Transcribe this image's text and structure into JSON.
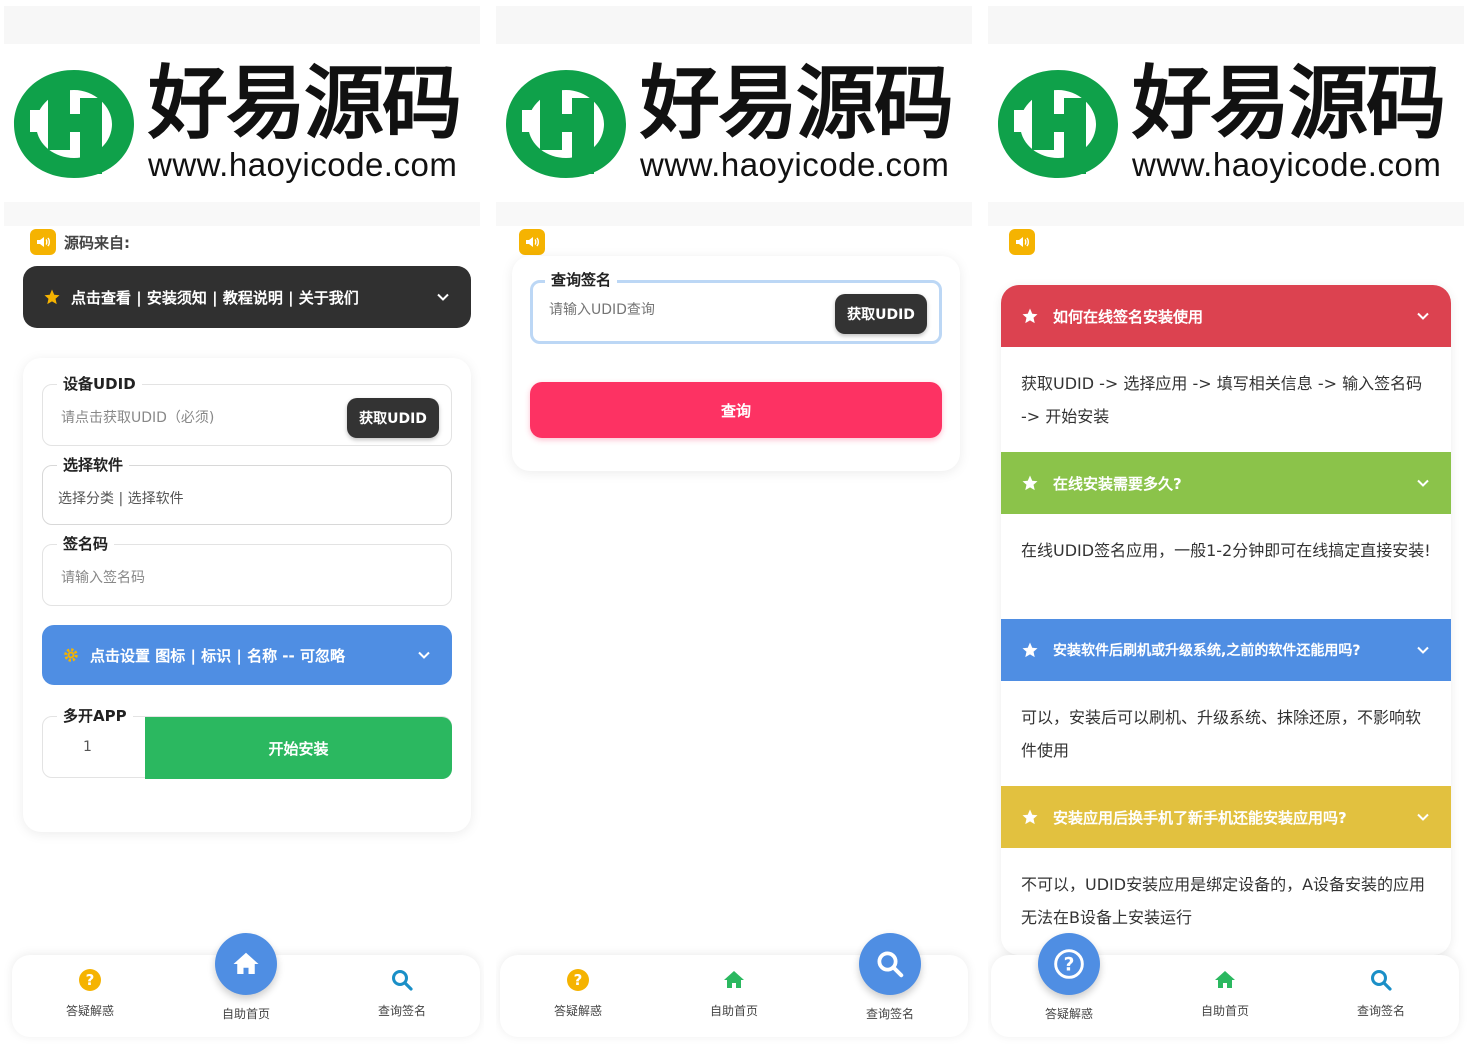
{
  "brand": {
    "name": "好易源码",
    "url": "www.haoyicode.com",
    "logo_green": "#0fa14a"
  },
  "panel1": {
    "notice": "源码来自:",
    "nav_bar_label": "点击查看 | 安装须知 | 教程说明 | 关于我们",
    "udid_field": {
      "label": "设备UDID",
      "placeholder": "请点击获取UDID（必须)",
      "button": "获取UDID"
    },
    "software_field": {
      "label": "选择软件",
      "value": "选择分类 | 选择软件"
    },
    "sign_code_field": {
      "label": "签名码",
      "placeholder": "请输入签名码"
    },
    "settings_bar_label": "点击设置 图标 | 标识 | 名称 -- 可忽略",
    "multi_app": {
      "label": "多开APP",
      "value": "1",
      "start_button": "开始安装"
    }
  },
  "panel2": {
    "query_field": {
      "label": "查询签名",
      "placeholder": "请输入UDID查询",
      "button": "获取UDID"
    },
    "query_button": "查询"
  },
  "panel3": {
    "faq": [
      {
        "question": "如何在线签名安装使用",
        "answer": "获取UDID -> 选择应用 -> 填写相关信息 -> 输入签名码 -> 开始安装",
        "color": "#dc4250"
      },
      {
        "question": "在线安装需要多久?",
        "answer": "在线UDID签名应用，一般1-2分钟即可在线搞定直接安装!",
        "color": "#8bc34a"
      },
      {
        "question": "安装软件后刷机或升级系统,之前的软件还能用吗?",
        "answer": "可以，安装后可以刷机、升级系统、抹除还原，不影响软件使用",
        "color": "#4f8ee3"
      },
      {
        "question": "安装应用后换手机了新手机还能安装应用吗?",
        "answer": "不可以，UDID安装应用是绑定设备的，A设备安装的应用无法在B设备上安装运行",
        "color": "#e2c13f"
      }
    ]
  },
  "tabbar": {
    "faq": "答疑解惑",
    "home": "自助首页",
    "query": "查询签名"
  },
  "colors": {
    "dark": "#303030",
    "blue": "#4f8ee3",
    "green": "#2bb860",
    "pink": "#fd3263",
    "amber": "#f5b301"
  }
}
